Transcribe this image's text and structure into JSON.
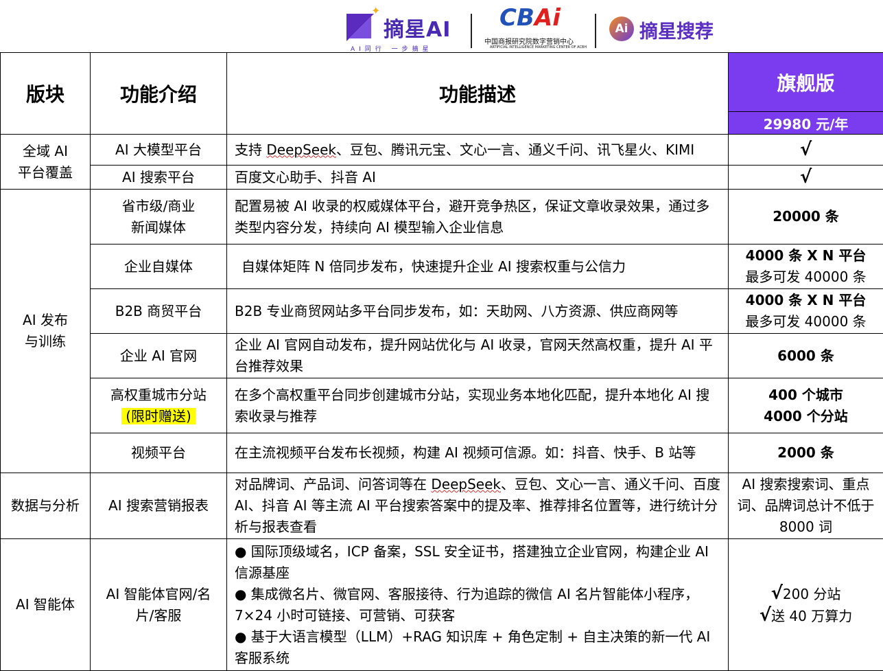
{
  "logos": {
    "logo1_name": "摘星AI",
    "logo1_slogan": "AI同行 一步摘星",
    "logo2_mark_a": "CB",
    "logo2_mark_b": "Ai",
    "logo2_cn": "中国商报研究院数字营销中心",
    "logo2_en": "ARTIFICIAL INTELLIGENCE MARKETING CENTER OF ACBH",
    "logo3_circle": "Ai",
    "logo3_name": "摘星搜荐"
  },
  "table": {
    "headers": {
      "section": "版块",
      "feature": "功能介绍",
      "description": "功能描述",
      "plan": "旗舰版",
      "price": "29980 元/年"
    },
    "rows": [
      {
        "section": "全域 AI 平台覆盖",
        "feature": "AI 大模型平台",
        "desc_pre": "支持 ",
        "desc_wavy": "DeepSeek",
        "desc_post": "、豆包、腾讯元宝、文心一言、通义千问、讯飞星火、KIMI",
        "value": "√"
      },
      {
        "feature": "AI 搜索平台",
        "desc": "百度文心助手、抖音 AI",
        "value": "√"
      },
      {
        "section": "AI 发布 与训练",
        "feature_l1": "省市级/商业",
        "feature_l2": "新闻媒体",
        "desc": "配置易被 AI 收录的权威媒体平台，避开竞争热区，保证文章收录效果，通过多类型内容分发，持续向 AI 模型输入企业信息",
        "value": "20000 条"
      },
      {
        "feature": "企业自媒体",
        "desc": "自媒体矩阵 N 倍同步发布，快速提升企业 AI 搜索权重与公信力",
        "value_l1": "4000 条 X N 平台",
        "value_l2": "最多可发 40000 条"
      },
      {
        "feature": "B2B 商贸平台",
        "desc": "B2B 专业商贸网站多平台同步发布，如：天助网、八方资源、供应商网等",
        "value_l1": "4000 条 X N 平台",
        "value_l2": "最多可发 40000 条"
      },
      {
        "feature": "企业 AI 官网",
        "desc": "企业 AI 官网自动发布，提升网站优化与 AI 收录，官网天然高权重，提升 AI 平台推荐效果",
        "value": "6000 条"
      },
      {
        "feature_l1": "高权重城市分站",
        "feature_tag": "(限时赠送)",
        "desc": "在多个高权重平台同步创建城市分站，实现业务本地化匹配，提升本地化 AI 搜索收录与推荐",
        "value_l1": "400 个城市",
        "value_l2": "4000  个分站"
      },
      {
        "feature": "视频平台",
        "desc": "在主流视频平台发布长视频，构建 AI 视频可信源。如：抖音、快手、B 站等",
        "value": "2000 条"
      },
      {
        "section": "数据与分析",
        "feature": "AI 搜索营销报表",
        "desc_pre": "对品牌词、产品词、问答词等在 ",
        "desc_wavy": "DeepSeek",
        "desc_post": "、豆包、文心一言、通义千问、百度 AI、抖音 AI 等主流 AI 平台搜索答案中的提及率、推荐排名位置等，进行统计分析与报表查看",
        "value": "AI 搜索搜索词、重点词、品牌词总计不低于 8000 词"
      },
      {
        "section": "AI 智能体",
        "feature": "AI 智能体官网/名片/客服",
        "bullets": [
          "● 国际顶级域名，ICP 备案，SSL 安全证书，搭建独立企业官网，构建企业 AI 信源基座",
          "● 集成微名片、微官网、客服接待、行为追踪的微信 AI 名片智能体小程序，7×24 小时可链接、可营销、可获客",
          "● 基于大语言模型（LLM）+RAG 知识库 + 角色定制 + 自主决策的新一代 AI 客服系统"
        ],
        "value_check": "√",
        "value_l1": "200 分站",
        "value_l2": "送 40 万算力"
      }
    ]
  }
}
